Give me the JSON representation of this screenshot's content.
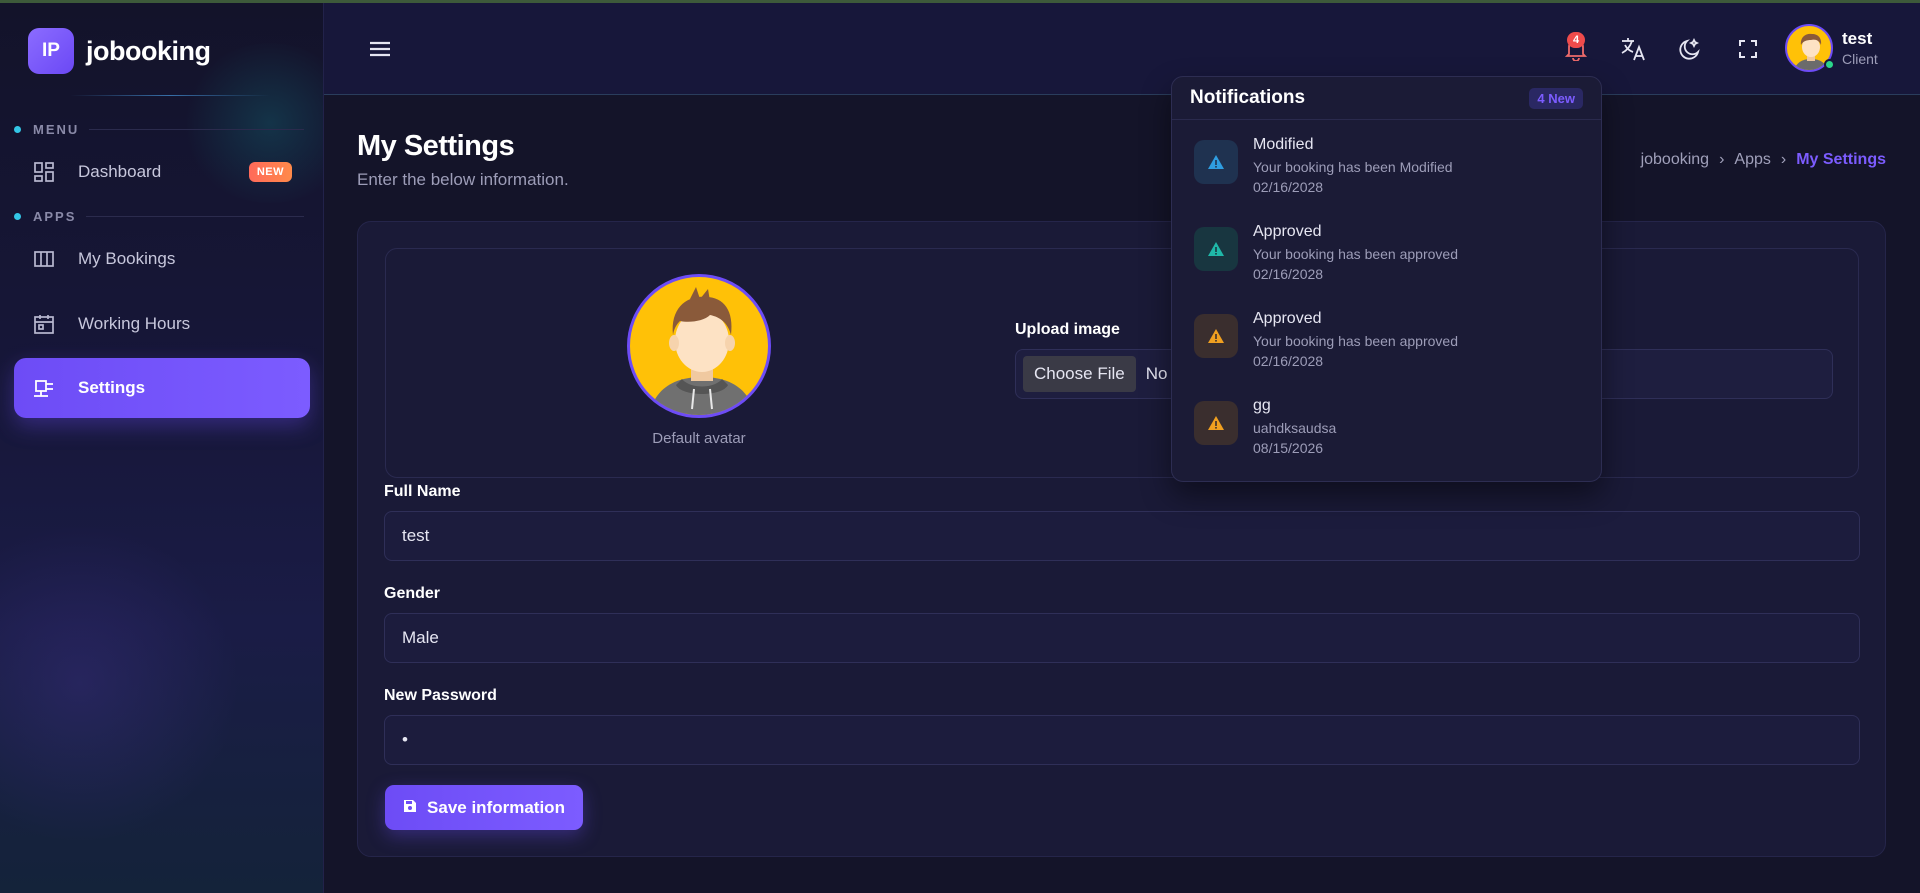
{
  "brand": {
    "logo": "IP",
    "name": "jobooking"
  },
  "sidebar": {
    "sections": [
      {
        "label": "MENU"
      },
      {
        "label": "APPS"
      }
    ],
    "items": [
      {
        "label": "Dashboard",
        "icon": "dashboard-grid-icon",
        "badge": "NEW"
      },
      {
        "label": "My Bookings",
        "icon": "columns-icon"
      },
      {
        "label": "Working Hours",
        "icon": "calendar-icon"
      },
      {
        "label": "Settings",
        "icon": "settings-icon",
        "active": true
      }
    ]
  },
  "header": {
    "notification_count": "4",
    "user": {
      "name": "test",
      "role": "Client"
    },
    "icons": [
      "menu-icon",
      "bell-icon",
      "translate-icon",
      "moon-icon",
      "fullscreen-icon"
    ]
  },
  "page": {
    "title": "My Settings",
    "subtitle": "Enter the below information.",
    "breadcrumb": [
      "jobooking",
      "Apps",
      "My Settings"
    ]
  },
  "form": {
    "avatar_caption": "Default avatar",
    "upload_label": "Upload image",
    "choose_file_label": "Choose File",
    "file_status": "No",
    "full_name": {
      "label": "Full Name",
      "value": "test"
    },
    "gender": {
      "label": "Gender",
      "value": "Male"
    },
    "password": {
      "label": "New Password",
      "value": "•"
    },
    "save_label": "Save information"
  },
  "notifications": {
    "title": "Notifications",
    "new_badge": "4 New",
    "items": [
      {
        "title": "Modified",
        "message": "Your booking has been Modified",
        "date": "02/16/2028",
        "icon": "warning-icon",
        "color": "#2f9de0"
      },
      {
        "title": "Approved",
        "message": "Your booking has been approved",
        "date": "02/16/2028",
        "icon": "warning-icon",
        "color": "#1fb8a8"
      },
      {
        "title": "Approved",
        "message": "Your booking has been approved",
        "date": "02/16/2028",
        "icon": "warning-icon",
        "color": "#f0a020"
      },
      {
        "title": "gg",
        "message": "uahdksaudsa",
        "date": "08/15/2026",
        "icon": "warning-icon",
        "color": "#f0a020"
      }
    ]
  },
  "colors": {
    "accent": "#7c5cff",
    "danger": "#ef4b4b",
    "online": "#2bd68a"
  }
}
